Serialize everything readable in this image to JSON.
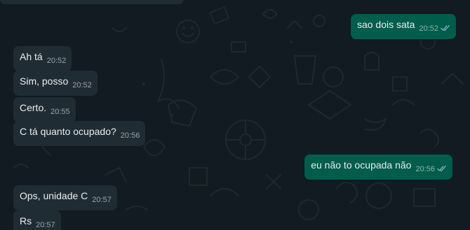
{
  "colors": {
    "background": "#111b21",
    "incoming_bubble": "#202c33",
    "outgoing_bubble": "#005c4b",
    "text": "#e9edef",
    "meta": "#8696a0",
    "read_ticks": "#8fb3c5"
  },
  "messages": [
    {
      "id": "m1",
      "direction": "outgoing",
      "text": "sao dois sata",
      "time": "20:52",
      "status_icon": "double-check-icon"
    },
    {
      "id": "m2",
      "direction": "incoming",
      "text": "Ah tá",
      "time": "20:52"
    },
    {
      "id": "m3",
      "direction": "incoming",
      "text": "Sim, posso",
      "time": "20:52"
    },
    {
      "id": "m4",
      "direction": "incoming",
      "text": "Certo.",
      "time": "20:55"
    },
    {
      "id": "m5",
      "direction": "incoming",
      "text": "C tá quanto ocupado?",
      "time": "20:56"
    },
    {
      "id": "m6",
      "direction": "outgoing",
      "text": "eu não to ocupada não",
      "time": "20:56",
      "status_icon": "double-check-icon"
    },
    {
      "id": "m7",
      "direction": "incoming",
      "text": "Ops,  unidade C",
      "time": "20:57"
    },
    {
      "id": "m8",
      "direction": "incoming",
      "text": "Rs",
      "time": "20:57"
    }
  ]
}
